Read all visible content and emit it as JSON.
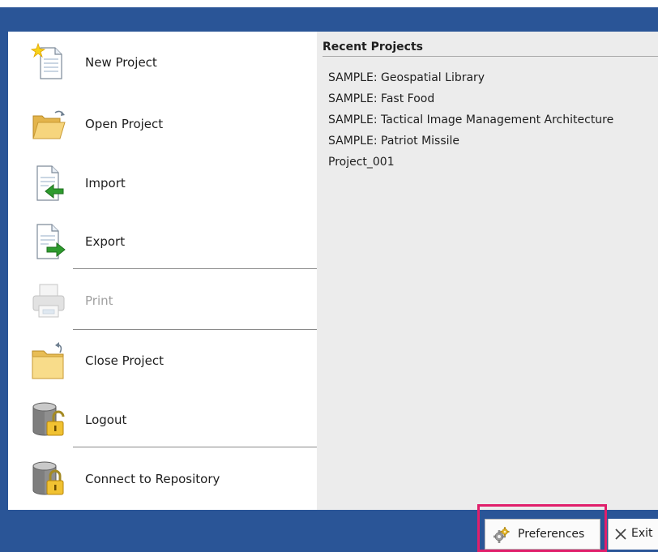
{
  "menu": {
    "new_project": "New Project",
    "open_project": "Open Project",
    "import": "Import",
    "export": "Export",
    "print": "Print",
    "close_project": "Close Project",
    "logout": "Logout",
    "connect_repository": "Connect to Repository"
  },
  "recent": {
    "title": "Recent Projects",
    "items": [
      "SAMPLE: Geospatial Library",
      "SAMPLE: Fast Food",
      "SAMPLE: Tactical Image Management Architecture",
      "SAMPLE: Patriot Missile",
      "Project_001"
    ]
  },
  "footer": {
    "preferences_label": "Preferences",
    "exit_label": "Exit"
  },
  "colors": {
    "frame": "#2a5597",
    "panel": "#ececec",
    "highlight": "#e01f6b"
  }
}
